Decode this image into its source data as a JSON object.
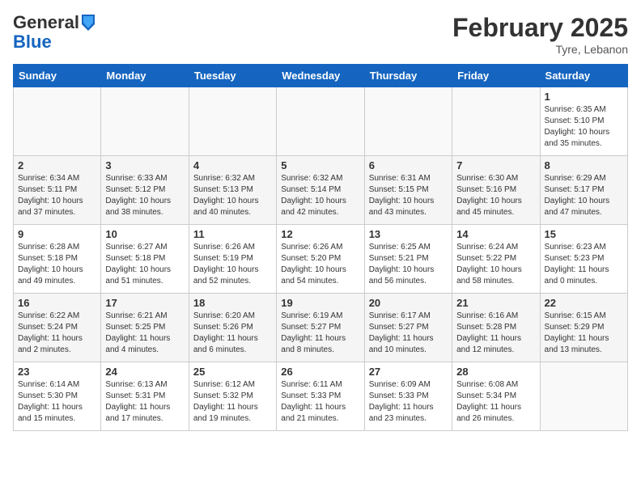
{
  "header": {
    "logo_general": "General",
    "logo_blue": "Blue",
    "month_title": "February 2025",
    "location": "Tyre, Lebanon"
  },
  "calendar": {
    "days_of_week": [
      "Sunday",
      "Monday",
      "Tuesday",
      "Wednesday",
      "Thursday",
      "Friday",
      "Saturday"
    ],
    "weeks": [
      [
        {
          "day": "",
          "info": ""
        },
        {
          "day": "",
          "info": ""
        },
        {
          "day": "",
          "info": ""
        },
        {
          "day": "",
          "info": ""
        },
        {
          "day": "",
          "info": ""
        },
        {
          "day": "",
          "info": ""
        },
        {
          "day": "1",
          "info": "Sunrise: 6:35 AM\nSunset: 5:10 PM\nDaylight: 10 hours\nand 35 minutes."
        }
      ],
      [
        {
          "day": "2",
          "info": "Sunrise: 6:34 AM\nSunset: 5:11 PM\nDaylight: 10 hours\nand 37 minutes."
        },
        {
          "day": "3",
          "info": "Sunrise: 6:33 AM\nSunset: 5:12 PM\nDaylight: 10 hours\nand 38 minutes."
        },
        {
          "day": "4",
          "info": "Sunrise: 6:32 AM\nSunset: 5:13 PM\nDaylight: 10 hours\nand 40 minutes."
        },
        {
          "day": "5",
          "info": "Sunrise: 6:32 AM\nSunset: 5:14 PM\nDaylight: 10 hours\nand 42 minutes."
        },
        {
          "day": "6",
          "info": "Sunrise: 6:31 AM\nSunset: 5:15 PM\nDaylight: 10 hours\nand 43 minutes."
        },
        {
          "day": "7",
          "info": "Sunrise: 6:30 AM\nSunset: 5:16 PM\nDaylight: 10 hours\nand 45 minutes."
        },
        {
          "day": "8",
          "info": "Sunrise: 6:29 AM\nSunset: 5:17 PM\nDaylight: 10 hours\nand 47 minutes."
        }
      ],
      [
        {
          "day": "9",
          "info": "Sunrise: 6:28 AM\nSunset: 5:18 PM\nDaylight: 10 hours\nand 49 minutes."
        },
        {
          "day": "10",
          "info": "Sunrise: 6:27 AM\nSunset: 5:18 PM\nDaylight: 10 hours\nand 51 minutes."
        },
        {
          "day": "11",
          "info": "Sunrise: 6:26 AM\nSunset: 5:19 PM\nDaylight: 10 hours\nand 52 minutes."
        },
        {
          "day": "12",
          "info": "Sunrise: 6:26 AM\nSunset: 5:20 PM\nDaylight: 10 hours\nand 54 minutes."
        },
        {
          "day": "13",
          "info": "Sunrise: 6:25 AM\nSunset: 5:21 PM\nDaylight: 10 hours\nand 56 minutes."
        },
        {
          "day": "14",
          "info": "Sunrise: 6:24 AM\nSunset: 5:22 PM\nDaylight: 10 hours\nand 58 minutes."
        },
        {
          "day": "15",
          "info": "Sunrise: 6:23 AM\nSunset: 5:23 PM\nDaylight: 11 hours\nand 0 minutes."
        }
      ],
      [
        {
          "day": "16",
          "info": "Sunrise: 6:22 AM\nSunset: 5:24 PM\nDaylight: 11 hours\nand 2 minutes."
        },
        {
          "day": "17",
          "info": "Sunrise: 6:21 AM\nSunset: 5:25 PM\nDaylight: 11 hours\nand 4 minutes."
        },
        {
          "day": "18",
          "info": "Sunrise: 6:20 AM\nSunset: 5:26 PM\nDaylight: 11 hours\nand 6 minutes."
        },
        {
          "day": "19",
          "info": "Sunrise: 6:19 AM\nSunset: 5:27 PM\nDaylight: 11 hours\nand 8 minutes."
        },
        {
          "day": "20",
          "info": "Sunrise: 6:17 AM\nSunset: 5:27 PM\nDaylight: 11 hours\nand 10 minutes."
        },
        {
          "day": "21",
          "info": "Sunrise: 6:16 AM\nSunset: 5:28 PM\nDaylight: 11 hours\nand 12 minutes."
        },
        {
          "day": "22",
          "info": "Sunrise: 6:15 AM\nSunset: 5:29 PM\nDaylight: 11 hours\nand 13 minutes."
        }
      ],
      [
        {
          "day": "23",
          "info": "Sunrise: 6:14 AM\nSunset: 5:30 PM\nDaylight: 11 hours\nand 15 minutes."
        },
        {
          "day": "24",
          "info": "Sunrise: 6:13 AM\nSunset: 5:31 PM\nDaylight: 11 hours\nand 17 minutes."
        },
        {
          "day": "25",
          "info": "Sunrise: 6:12 AM\nSunset: 5:32 PM\nDaylight: 11 hours\nand 19 minutes."
        },
        {
          "day": "26",
          "info": "Sunrise: 6:11 AM\nSunset: 5:33 PM\nDaylight: 11 hours\nand 21 minutes."
        },
        {
          "day": "27",
          "info": "Sunrise: 6:09 AM\nSunset: 5:33 PM\nDaylight: 11 hours\nand 23 minutes."
        },
        {
          "day": "28",
          "info": "Sunrise: 6:08 AM\nSunset: 5:34 PM\nDaylight: 11 hours\nand 26 minutes."
        },
        {
          "day": "",
          "info": ""
        }
      ]
    ]
  }
}
